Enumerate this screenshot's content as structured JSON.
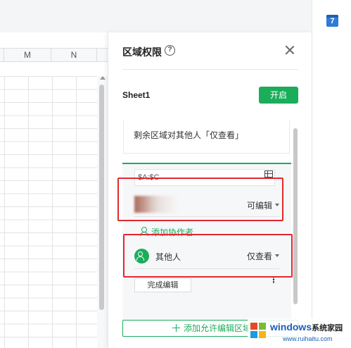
{
  "sheet": {
    "columns": [
      "M",
      "N"
    ]
  },
  "calendar_icon": {
    "day": "7"
  },
  "panel": {
    "title": "区域权限",
    "help_glyph": "?",
    "sheet_name": "Sheet1",
    "enable_label": "开启",
    "rest_permission_text": "剩余区域对其他人「仅查看」",
    "range": {
      "value": "$A:$C",
      "editor": {
        "name": "",
        "permission": "可编辑"
      },
      "add_collaborator_label": "添加协作者",
      "others": {
        "label": "其他人",
        "permission": "仅查看"
      },
      "done_label": "完成编辑",
      "more_glyph": "⋮"
    },
    "add_area_label": "添加允许编辑区域"
  },
  "colors": {
    "accent_green": "#1aad5a",
    "annotation_red": "#e4282f"
  },
  "watermark": {
    "brand": "windows",
    "brand_cn": "系统家园",
    "url": "www.ruihaitu.com"
  }
}
